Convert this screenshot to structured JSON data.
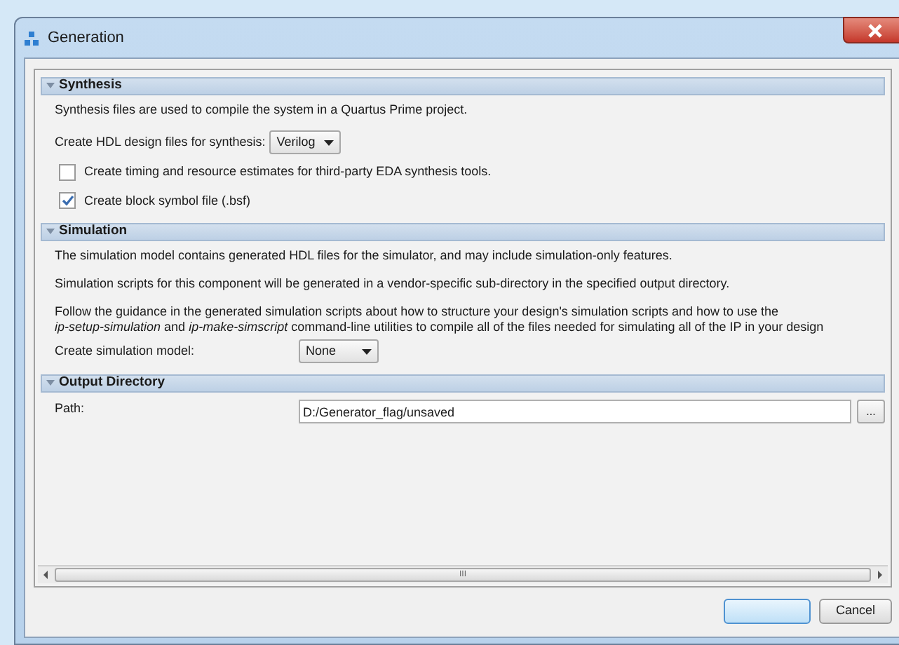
{
  "window": {
    "title": "Generation"
  },
  "sections": [
    {
      "title": "Synthesis",
      "expanded": true,
      "rows": [
        {
          "kind": "text",
          "text": "Synthesis files are used to compile the system in a Quartus Prime project."
        },
        {
          "kind": "inline_dropdown",
          "label": "Create HDL design files for synthesis:",
          "value": "Verilog"
        },
        {
          "kind": "checkbox",
          "label": "Create timing and resource estimates for third-party EDA synthesis tools.",
          "checked": false
        },
        {
          "kind": "checkbox",
          "label": "Create block symbol file (.bsf)",
          "checked": true
        }
      ]
    },
    {
      "title": "Simulation",
      "expanded": true,
      "rows": [
        {
          "kind": "text",
          "text": "The simulation model contains generated HDL files for the simulator, and may include simulation-only features."
        },
        {
          "kind": "text",
          "text": "Simulation scripts for this component will be generated in a vendor-specific sub-directory in the specified output directory."
        },
        {
          "kind": "lines",
          "lines": [
            "Follow the guidance in the generated simulation scripts about how to structure your design's simulation scripts and how to use the",
            "*ip-setup-simulation* and *ip-make-simscript* command-line utilities to compile all of the files needed for simulating all of the IP in your design"
          ]
        },
        {
          "kind": "column_dropdown",
          "label": "Create simulation model:",
          "value": "None"
        }
      ]
    },
    {
      "title": "Output Directory",
      "expanded": true,
      "rows": [
        {
          "kind": "path",
          "label": "Path:",
          "value": "D:/Generator_flag/unsaved",
          "browse": "..."
        }
      ]
    }
  ],
  "scrollbar": {
    "grip": "III"
  },
  "buttons": [
    {
      "default": true
    },
    {
      "label": "Cancel",
      "default": false
    }
  ]
}
